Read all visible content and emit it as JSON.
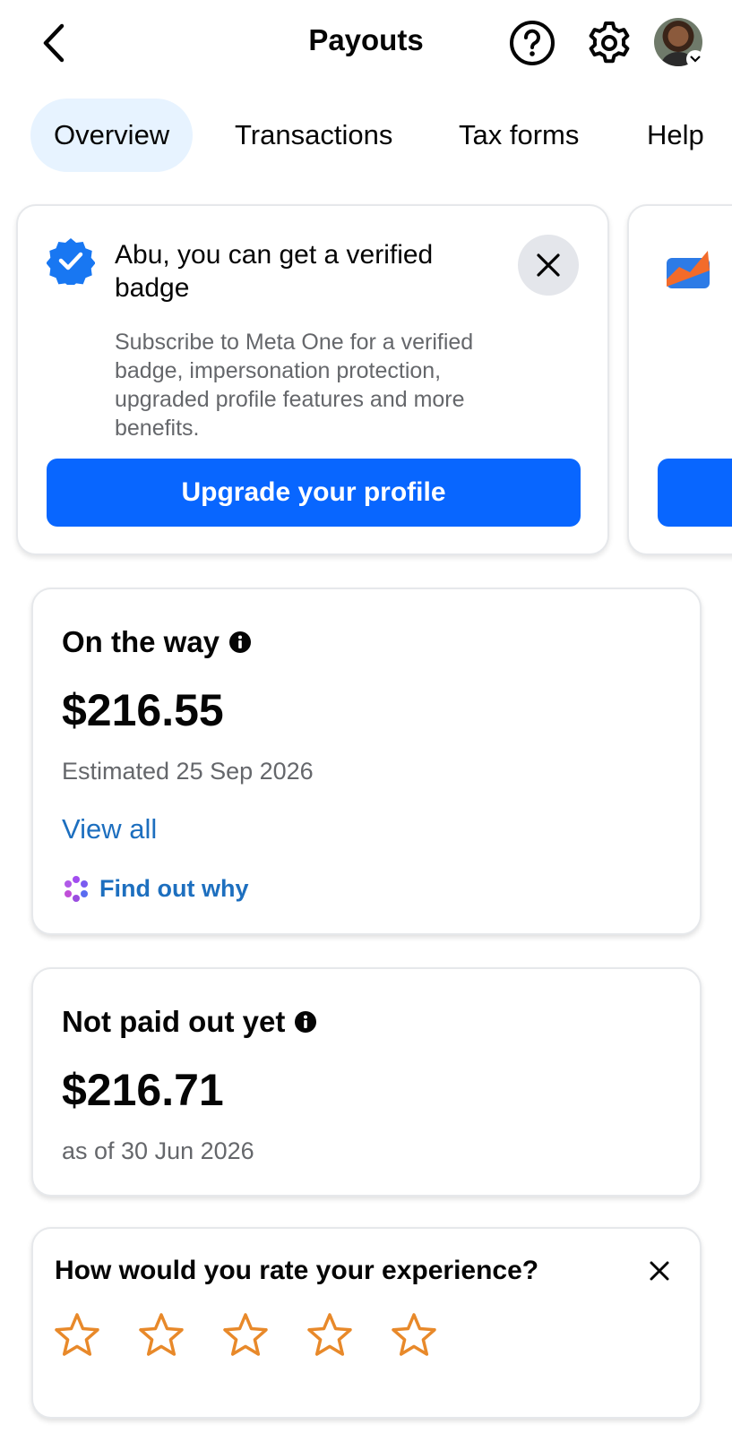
{
  "header": {
    "title": "Payouts",
    "icons": [
      "back-arrow",
      "help-circle",
      "gear",
      "avatar"
    ]
  },
  "tabs": [
    {
      "label": "Overview",
      "active": true
    },
    {
      "label": "Transactions",
      "active": false
    },
    {
      "label": "Tax forms",
      "active": false
    },
    {
      "label": "Help",
      "active": false
    }
  ],
  "promo": {
    "title": "Abu, you can get a verified badge",
    "body": "Subscribe to Meta One for a verified badge, impersonation protection, upgraded profile features and more benefits.",
    "button": "Upgrade your profile"
  },
  "on_the_way": {
    "label": "On the way",
    "amount": "$216.55",
    "estimate": "Estimated 25 Sep 2026",
    "view_all": "View all",
    "find_out": "Find out why"
  },
  "not_paid": {
    "label": "Not paid out yet",
    "amount": "$216.71",
    "as_of": "as of 30 Jun 2026"
  },
  "rating": {
    "question": "How would you rate your experience?",
    "stars": 5,
    "selected": 0
  },
  "colors": {
    "accent": "#0866ff",
    "link": "#1d6fbf",
    "star": "#e8892a",
    "tab_active_bg": "#e7f3ff",
    "muted": "#65676b"
  }
}
